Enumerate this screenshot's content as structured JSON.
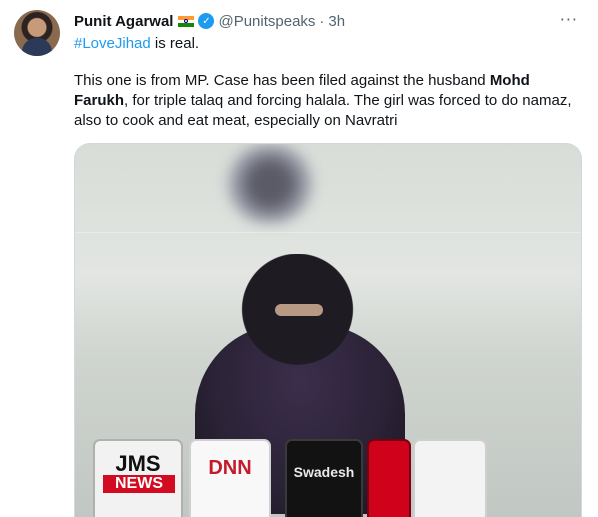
{
  "author": {
    "name": "Punit Agarwal",
    "handle": "@Punitspeaks",
    "separator": "·",
    "time": "3h"
  },
  "more_menu": {
    "label": "···"
  },
  "tweet": {
    "hashtag": "#LoveJihad",
    "line1_rest": " is real.",
    "p2_a": "This one is from MP. Case has been filed against the husband ",
    "p2_bold": "Mohd Farukh",
    "p2_b": ", for triple talaq and forcing halala. The girl was forced to do namaz, also to cook and eat meat, especially on Navratri"
  },
  "media": {
    "mic_jms": "JMS",
    "mic_jms_news": "NEWS",
    "mic_dnn": "DNN",
    "mic_swadesh": "Swadesh"
  },
  "colors": {
    "link": "#1d9bf0",
    "text": "#0f1419",
    "secondary": "#536471"
  },
  "icons": {
    "verified": "verified-badge-icon",
    "flag": "india-flag-icon",
    "more": "more-horizontal-icon"
  }
}
